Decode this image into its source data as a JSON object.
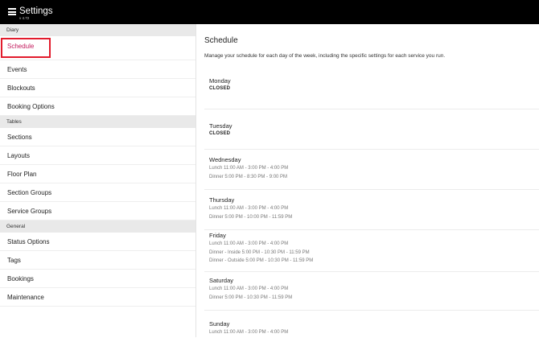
{
  "header": {
    "title": "Settings",
    "version": "v 4.72"
  },
  "sidebar": {
    "sections": [
      {
        "title": "Diary",
        "items": [
          "Schedule",
          "Events",
          "Blockouts",
          "Booking Options"
        ]
      },
      {
        "title": "Tables",
        "items": [
          "Sections",
          "Layouts",
          "Floor Plan",
          "Section Groups",
          "Service Groups"
        ]
      },
      {
        "title": "General",
        "items": [
          "Status Options",
          "Tags",
          "Bookings",
          "Maintenance"
        ]
      }
    ],
    "active_item": "Schedule"
  },
  "main": {
    "title": "Schedule",
    "description": "Manage your schedule for each day of the week, including the specific settings for each service you run.",
    "days": [
      {
        "name": "Monday",
        "status": "CLOSED",
        "services": []
      },
      {
        "name": "Tuesday",
        "status": "CLOSED",
        "services": []
      },
      {
        "name": "Wednesday",
        "status": "",
        "services": [
          "Lunch 11:00 AM - 3:00 PM - 4:00 PM",
          "Dinner 5:00 PM - 8:30 PM - 9:00 PM"
        ]
      },
      {
        "name": "Thursday",
        "status": "",
        "services": [
          "Lunch 11:00 AM - 3:00 PM - 4:00 PM",
          "Dinner 5:00 PM - 10:00 PM - 11:59 PM"
        ]
      },
      {
        "name": "Friday",
        "status": "",
        "services": [
          "Lunch 11:00 AM - 3:00 PM - 4:00 PM",
          "Dinner - Inside 5:00 PM - 10:30 PM - 11:59 PM",
          "Dinner - Outside 5:00 PM - 10:30 PM - 11:59 PM"
        ]
      },
      {
        "name": "Saturday",
        "status": "",
        "services": [
          "Lunch 11:00 AM - 3:00 PM - 4:00 PM",
          "Dinner 5:00 PM - 10:30 PM - 11:59 PM"
        ]
      },
      {
        "name": "Sunday",
        "status": "",
        "services": [
          "Lunch 11:00 AM - 3:00 PM - 4:00 PM"
        ]
      }
    ]
  },
  "colors": {
    "topbar": "#000000",
    "active_item": "#c2185b",
    "highlight_box": "#e21b2c",
    "section_bg": "#e9e9e9"
  }
}
